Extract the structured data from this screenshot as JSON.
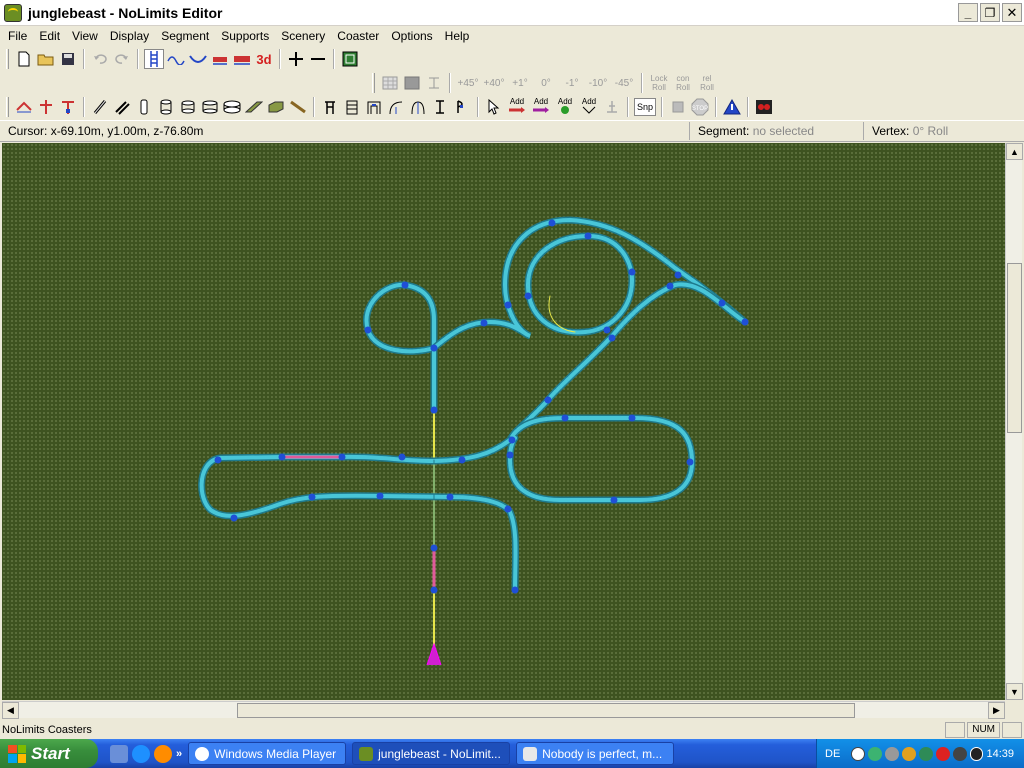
{
  "window": {
    "title": "junglebeast - NoLimits Editor",
    "minimize": "_",
    "maximize": "❐",
    "close": "✕"
  },
  "menu": [
    "File",
    "Edit",
    "View",
    "Display",
    "Segment",
    "Supports",
    "Scenery",
    "Coaster",
    "Options",
    "Help"
  ],
  "toolbar_angles": {
    "plus45": "+45°",
    "plus40": "+40°",
    "plus1": "+1°",
    "zero": "0°",
    "minus1": "-1°",
    "minus10": "-10°",
    "minus45": "-45°",
    "lock_roll": "Lock Roll",
    "con_roll": "con Roll",
    "rel_roll": "rel Roll"
  },
  "toolbar_add": {
    "add1": "Add",
    "add2": "Add",
    "add3": "Add",
    "add4": "Add",
    "snp": "Snp",
    "stop": "STOP",
    "threed": "3d"
  },
  "infobar": {
    "cursor_label": "Cursor:",
    "cursor_value": "x-69.10m, y1.00m, z-76.80m",
    "segment_label": "Segment:",
    "segment_value": "no selected",
    "vertex_label": "Vertex:",
    "vertex_value": "0° Roll"
  },
  "status": {
    "text": "NoLimits Coasters",
    "num": "NUM"
  },
  "taskbar": {
    "start": "Start",
    "tasks": [
      {
        "label": "Windows Media Player",
        "active": false
      },
      {
        "label": "junglebeast - NoLimit...",
        "active": true
      },
      {
        "label": "Nobody is perfect, m...",
        "active": false
      }
    ],
    "lang": "DE",
    "clock": "14:39"
  },
  "colors": {
    "track": "#49c6d8",
    "node": "#1f4fd6",
    "highlight_pink": "#e05a9a",
    "lift_yellow": "#e6e64a",
    "grass": "#3e5320"
  }
}
